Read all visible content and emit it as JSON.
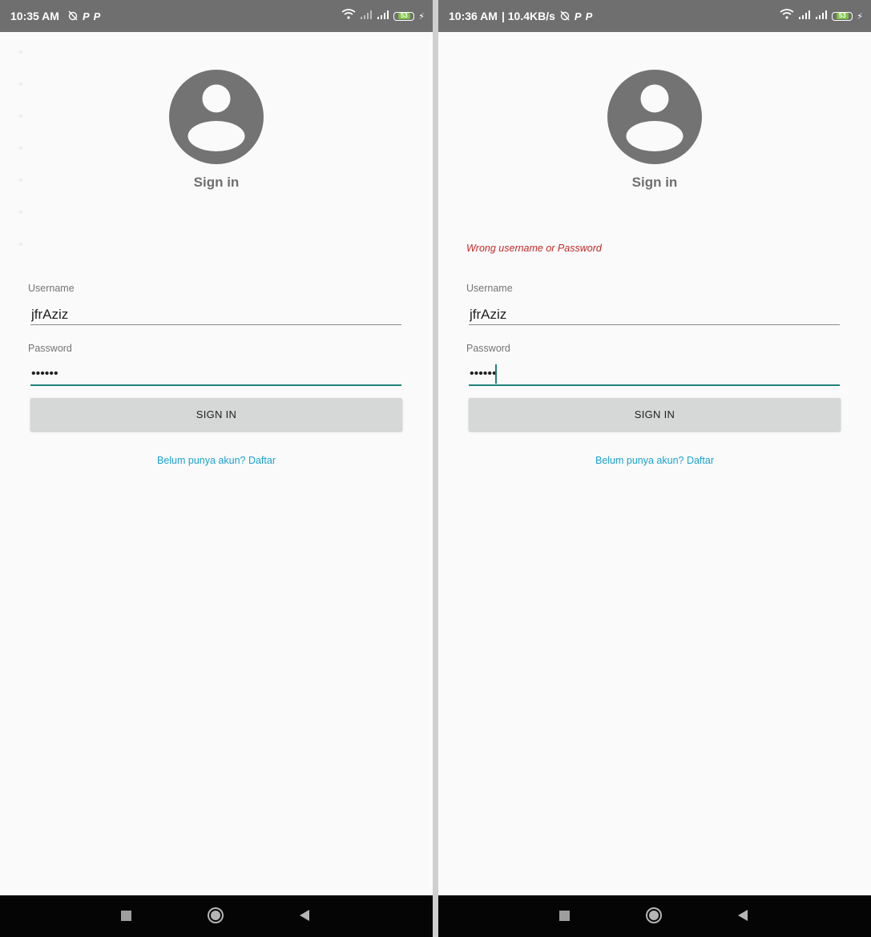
{
  "left": {
    "status": {
      "time": "10:35 AM",
      "net_speed": "",
      "battery": "53"
    },
    "title": "Sign in",
    "error": "",
    "username": {
      "label": "Username",
      "value": "jfrAziz"
    },
    "password": {
      "label": "Password",
      "value": "••••••"
    },
    "signin_label": "SIGN IN",
    "register_link": "Belum punya akun? Daftar"
  },
  "right": {
    "status": {
      "time": "10:36 AM",
      "net_speed": "| 10.4KB/s",
      "battery": "53"
    },
    "title": "Sign in",
    "error": "Wrong username or Password",
    "username": {
      "label": "Username",
      "value": "jfrAziz"
    },
    "password": {
      "label": "Password",
      "value": "••••••"
    },
    "signin_label": "SIGN IN",
    "register_link": "Belum punya akun? Daftar"
  },
  "icons": {
    "alarm": "alarm-off-icon",
    "p_app": "parking-app-icon",
    "wifi": "wifi-icon",
    "signal": "signal-bars-icon",
    "battery": "battery-icon",
    "charging": "charging-bolt-icon",
    "avatar": "account-circle-icon",
    "recents": "recents-square-icon",
    "home": "home-circle-icon",
    "back": "back-triangle-icon"
  },
  "colors": {
    "status_bar": "#6f6f6f",
    "accent": "#1e8378",
    "error": "#c62828",
    "link": "#1ba2cf",
    "button": "#d6d7d7",
    "background": "#fafafa"
  }
}
